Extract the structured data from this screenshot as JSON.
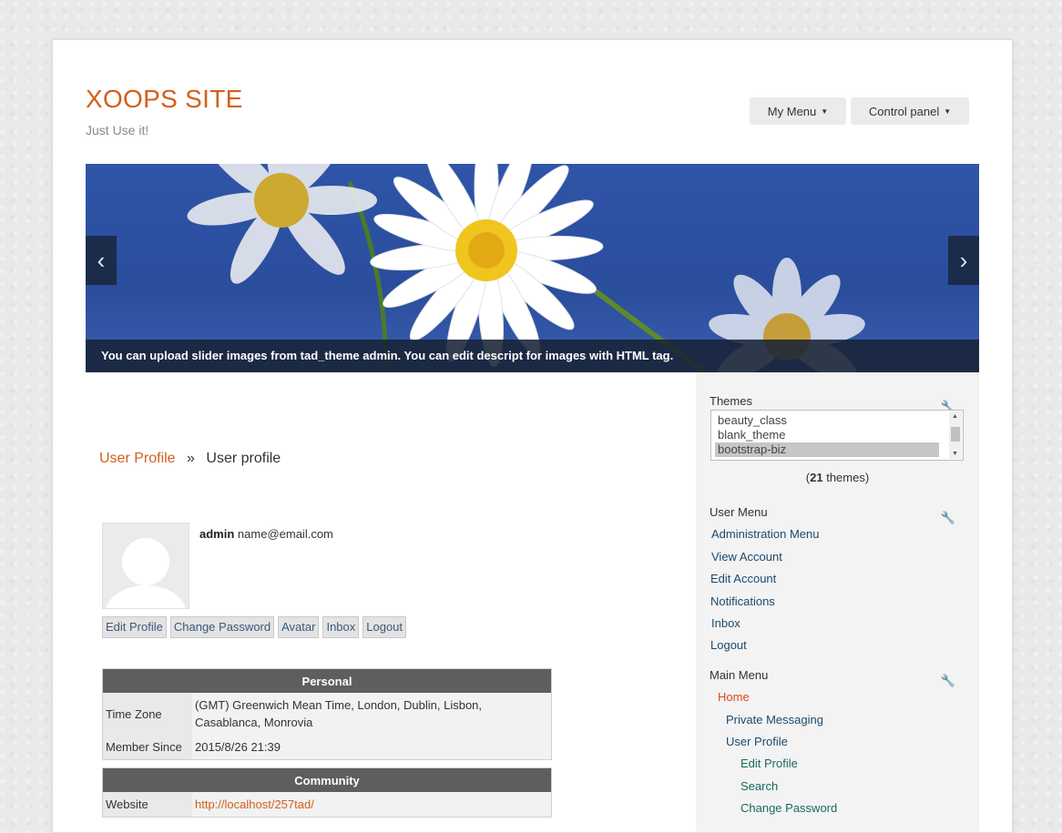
{
  "site": {
    "title": "XOOPS SITE",
    "slogan": "Just Use it!"
  },
  "top_menu": {
    "my_menu": "My Menu",
    "control_panel": "Control panel"
  },
  "slider": {
    "caption": "You can upload slider images from tad_theme admin. You can edit descript for images with HTML tag.",
    "prev_icon": "chevron-left-icon",
    "next_icon": "chevron-right-icon",
    "colors": {
      "sky": "#2f55a8",
      "caption_bg": "#182236"
    }
  },
  "breadcrumb": {
    "parent": "User Profile",
    "separator": "»",
    "current": "User profile"
  },
  "user": {
    "username": "admin",
    "email": "name@email.com",
    "buttons": [
      "Edit Profile",
      "Change Password",
      "Avatar",
      "Inbox",
      "Logout"
    ]
  },
  "personal": {
    "title": "Personal",
    "rows": [
      {
        "label": "Time Zone",
        "value": "(GMT) Greenwich Mean Time, London, Dublin, Lisbon, Casablanca, Monrovia"
      },
      {
        "label": "Member Since",
        "value": "2015/8/26 21:39"
      }
    ]
  },
  "community": {
    "title": "Community",
    "rows": [
      {
        "label": "Website",
        "value": "http://localhost/257tad/"
      }
    ]
  },
  "themes_block": {
    "title": "Themes",
    "options": [
      "beauty_class",
      "blank_theme",
      "bootstrap-biz"
    ],
    "selected": "bootstrap-biz",
    "count": "21",
    "count_suffix": "themes"
  },
  "user_menu": {
    "title": "User Menu",
    "items": [
      "Administration Menu",
      "View Account",
      "Edit Account",
      "Notifications",
      "Inbox",
      "Logout"
    ]
  },
  "main_menu": {
    "title": "Main Menu",
    "home": "Home",
    "level1": [
      "Private Messaging",
      "User Profile"
    ],
    "level2": [
      "Edit Profile",
      "Search",
      "Change Password"
    ]
  },
  "colors": {
    "accent": "#d2601a",
    "table_header": "#5e5e5e",
    "link": "#1c4a6e"
  }
}
